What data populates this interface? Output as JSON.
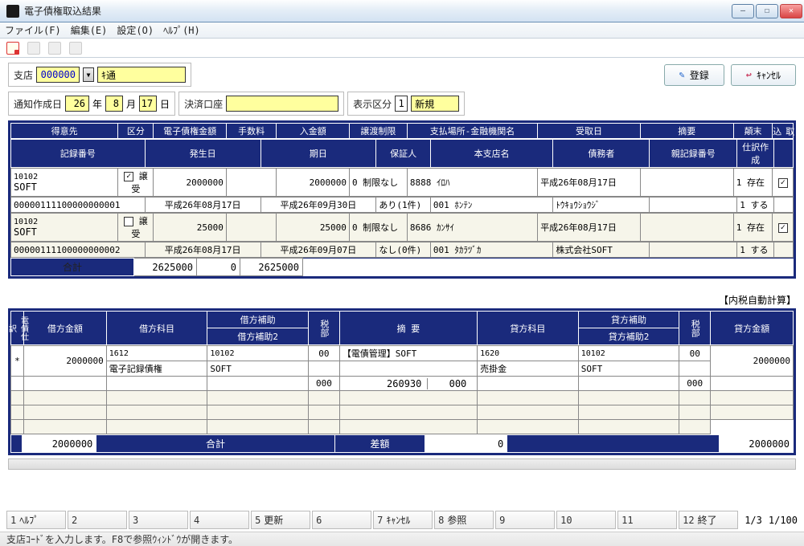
{
  "window": {
    "title": "電子債権取込結果"
  },
  "menu": {
    "file": "ファイル(F)",
    "edit": "編集(E)",
    "settings": "設定(O)",
    "help": "ﾍﾙﾌﾟ(H)"
  },
  "top": {
    "branch_label": "支店",
    "branch_code": "000000",
    "branch_name": "ｷ通",
    "register_btn": "登録",
    "cancel_btn": "ｷｬﾝｾﾙ"
  },
  "filter": {
    "notice_date_label": "通知作成日",
    "year": "26",
    "year_suffix": "年",
    "month": "8",
    "month_suffix": "月",
    "day": "17",
    "day_suffix": "日",
    "settle_acct_label": "決済口座",
    "settle_acct_value": "",
    "disp_kbn_label": "表示区分",
    "disp_kbn_code": "1",
    "disp_kbn_name": "新規"
  },
  "grid": {
    "h1": [
      "得意先",
      "区分",
      "電子債権金額",
      "手数料",
      "入金額",
      "譲渡制限",
      "支払場所-金融機関名",
      "受取日",
      "摘要",
      "顛末",
      "取込"
    ],
    "h2": [
      "記録番号",
      "発生日",
      "期日",
      "保証人",
      "本支店名",
      "債務者",
      "親記録番号",
      "仕訳作成"
    ],
    "rows": [
      {
        "cust_code": "10102",
        "cust_name": "SOFT",
        "kbn": "譲受",
        "chk": true,
        "amount": "2000000",
        "fee": "",
        "deposit": "2000000",
        "limit": "0 制限なし",
        "bank": "8888 ｲﾛﾊ",
        "recv_date": "平成26年08月17日",
        "memo": "",
        "tenmatsu": "1 存在",
        "record_no": "00000111100000000001",
        "issue": "平成26年08月17日",
        "due": "平成26年09月30日",
        "guarantor": "あり(1件)",
        "branch": "001 ﾎﾝﾃﾝ",
        "debtor": "ﾄｳｷｮｳｼｮｳｼﾞ",
        "parent": "",
        "journal": "1 する",
        "side_chk": true
      },
      {
        "cust_code": "10102",
        "cust_name": "SOFT",
        "kbn": "譲受",
        "chk": false,
        "amount": "25000",
        "fee": "",
        "deposit": "25000",
        "limit": "0 制限なし",
        "bank": "8686 ｶﾝｻｲ",
        "recv_date": "平成26年08月17日",
        "memo": "",
        "tenmatsu": "1 存在",
        "record_no": "00000111100000000002",
        "issue": "平成26年08月17日",
        "due": "平成26年09月07日",
        "guarantor": "なし(0件)",
        "branch": "001 ﾀｶﾗﾂﾞｶ",
        "debtor": "株式会社SOFT",
        "parent": "",
        "journal": "1 する",
        "side_chk": true
      }
    ],
    "sum_label": "合計",
    "sum_amount": "2625000",
    "sum_fee": "0",
    "sum_deposit": "2625000"
  },
  "right_note": "【内税自動計算】",
  "journal": {
    "strip_label": "電債仕訳",
    "head1": [
      "借方金額",
      "借方科目",
      "借方補助",
      "税部",
      "摘 要",
      "貸方科目",
      "貸方補助",
      "税部",
      "貸方金額"
    ],
    "head2": [
      "",
      "",
      "借方補助2",
      "",
      "",
      "",
      "貸方補助2",
      "",
      ""
    ],
    "row_mark": "*",
    "dr_amt": "2000000",
    "dr_acct_code": "1612",
    "dr_acct_name": "電子記録債権",
    "dr_sub_code": "10102",
    "dr_sub_name": "SOFT",
    "dr_sub2": "",
    "tax_dr": "00",
    "tax_dr2": "000",
    "memo1": "【電債管理】SOFT",
    "memo2a": "260930",
    "memo2b": "000",
    "cr_acct_code": "1620",
    "cr_acct_name": "売掛金",
    "cr_sub_code": "10102",
    "cr_sub_name": "SOFT",
    "cr_sub2": "",
    "tax_cr": "00",
    "tax_cr2": "000",
    "cr_amt": "2000000",
    "sum_dr": "2000000",
    "sum_label": "合計",
    "diff_label": "差額",
    "diff_val": "0",
    "sum_cr": "2000000"
  },
  "fkeys": [
    {
      "n": "1",
      "t": "ﾍﾙﾌﾟ"
    },
    {
      "n": "2",
      "t": ""
    },
    {
      "n": "3",
      "t": ""
    },
    {
      "n": "4",
      "t": ""
    },
    {
      "n": "5",
      "t": "更新"
    },
    {
      "n": "6",
      "t": ""
    },
    {
      "n": "7",
      "t": "ｷｬﾝｾﾙ"
    },
    {
      "n": "8",
      "t": "参照"
    },
    {
      "n": "9",
      "t": ""
    },
    {
      "n": "10",
      "t": ""
    },
    {
      "n": "11",
      "t": ""
    },
    {
      "n": "12",
      "t": "終了"
    }
  ],
  "paging": {
    "main": "1/3",
    "sub": "1/100"
  },
  "status": "支店ｺｰﾄﾞを入力します。F8で参照ｳｨﾝﾄﾞｳが開きます。"
}
